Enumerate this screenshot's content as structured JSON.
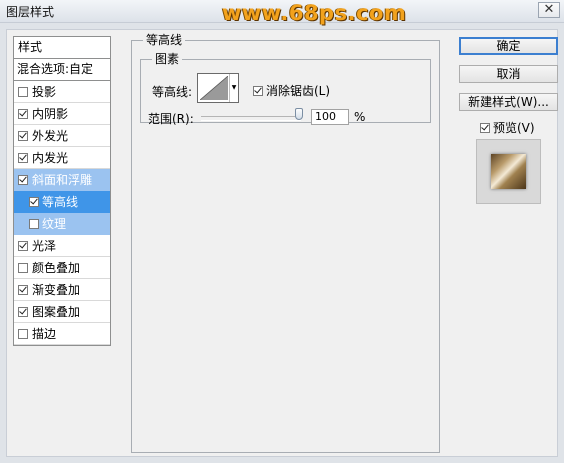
{
  "window": {
    "title": "图层样式",
    "watermark": "www.68ps.com",
    "close_glyph": "✕"
  },
  "style_list": {
    "header": "样式",
    "blend_options": "混合选项:自定",
    "items": [
      {
        "label": "投影",
        "checked": false
      },
      {
        "label": "内阴影",
        "checked": true
      },
      {
        "label": "外发光",
        "checked": true
      },
      {
        "label": "内发光",
        "checked": true
      },
      {
        "label": "斜面和浮雕",
        "checked": true
      },
      {
        "label": "等高线",
        "checked": true
      },
      {
        "label": "纹理",
        "checked": false
      },
      {
        "label": "光泽",
        "checked": true
      },
      {
        "label": "颜色叠加",
        "checked": false
      },
      {
        "label": "渐变叠加",
        "checked": true
      },
      {
        "label": "图案叠加",
        "checked": true
      },
      {
        "label": "描边",
        "checked": false
      }
    ]
  },
  "contour_panel": {
    "group_title": "等高线",
    "subgroup_title": "图素",
    "contour_label": "等高线:",
    "anti_alias_label": "消除锯齿(L)",
    "anti_alias_checked": true,
    "range_label": "范围(R):",
    "range_value": "100",
    "range_unit": "%",
    "range_percent": 100
  },
  "buttons": {
    "ok": "确定",
    "cancel": "取消",
    "new_style": "新建样式(W)...",
    "preview_label": "预览(V)",
    "preview_checked": true
  }
}
